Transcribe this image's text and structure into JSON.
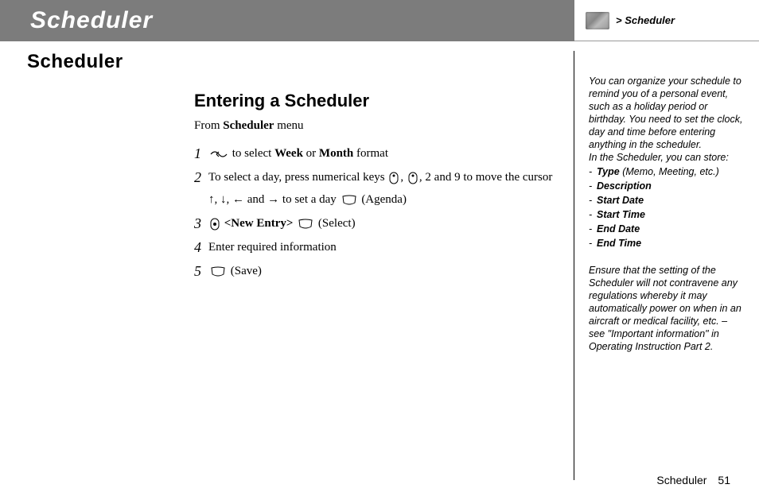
{
  "header": {
    "title": "Scheduler",
    "breadcrumb": "> Scheduler"
  },
  "main": {
    "section_title": "Scheduler",
    "sub_title": "Entering a Scheduler",
    "from_prefix": "From ",
    "from_bold": "Scheduler",
    "from_suffix": " menu",
    "steps": {
      "s1_a": " to select ",
      "s1_b": "Week",
      "s1_c": " or ",
      "s1_d": "Month",
      "s1_e": " format",
      "s2_a": "To select a day, press numerical keys ",
      "s2_b": ", ",
      "s2_c": ", 2 and 9 to move the cursor ↑, ↓, ← and → to set a day ",
      "s2_d": " (Agenda)",
      "s3_a": " ",
      "s3_b": "<New Entry>",
      "s3_c": " ",
      "s3_d": " (Select)",
      "s4": "Enter required information",
      "s5_a": " (Save)"
    }
  },
  "side": {
    "p1": "You can organize your schedule to remind you of a personal event, such as a holiday period or birthday. You need to set the clock, day and time before entering anything in the scheduler.",
    "p2": "In the Scheduler, you can store:",
    "items": {
      "type_label": "Type",
      "type_suffix": " (Memo, Meeting, etc.)",
      "desc": "Description",
      "sdate": "Start Date",
      "stime": "Start Time",
      "edate": "End Date",
      "etime": "End Time"
    },
    "p3": "Ensure that the setting of the Scheduler will not contravene any regulations whereby it may automatically power on when in an aircraft or medical facility, etc. – see \"Important information\" in Operating Instruction Part 2."
  },
  "footer": {
    "label": "Scheduler",
    "page": "51"
  }
}
